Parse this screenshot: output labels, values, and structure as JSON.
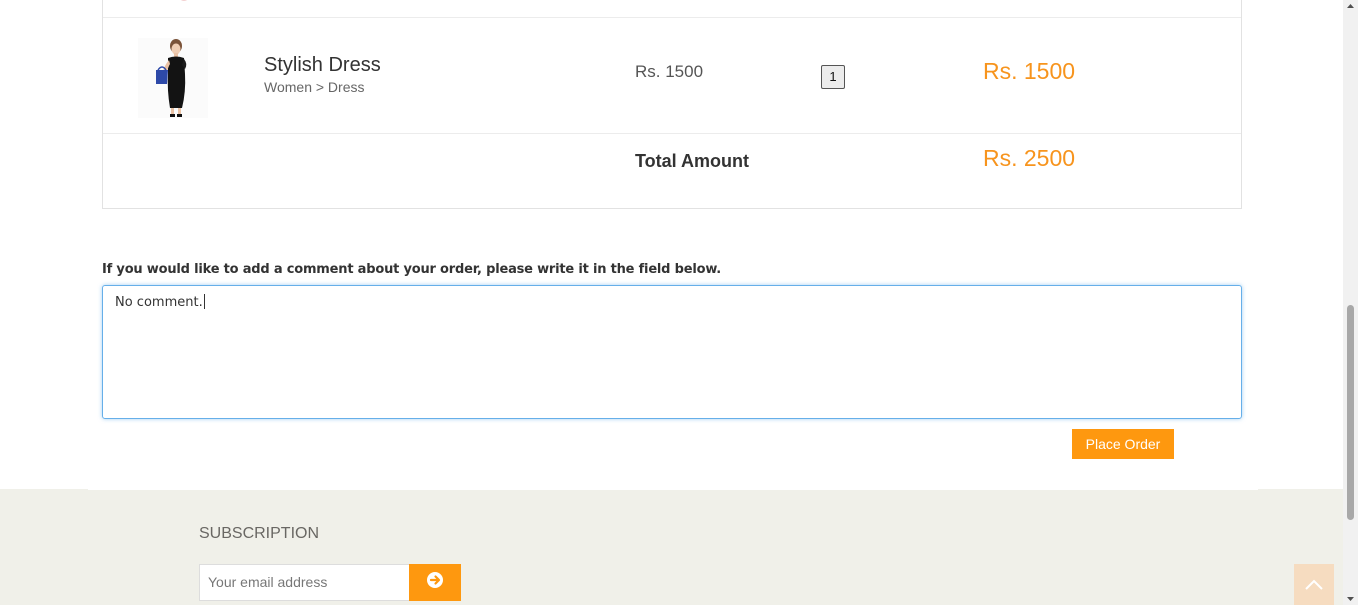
{
  "cart": {
    "item": {
      "name": "Stylish Dress",
      "category": "Women > Dress",
      "unit_price": "Rs. 1500",
      "quantity": "1",
      "line_total": "Rs. 1500"
    },
    "total_label": "Total Amount",
    "total_value": "Rs. 2500"
  },
  "comment": {
    "label": "If you would like to add a comment about your order, please write it in the field below.",
    "value": "No comment."
  },
  "place_order_label": "Place Order",
  "footer": {
    "subscription_title": "SUBSCRIPTION",
    "email_placeholder": "Your email address"
  },
  "colors": {
    "accent": "#fe980f",
    "price": "#f7941d",
    "footer_bg": "#f0f0e9"
  }
}
